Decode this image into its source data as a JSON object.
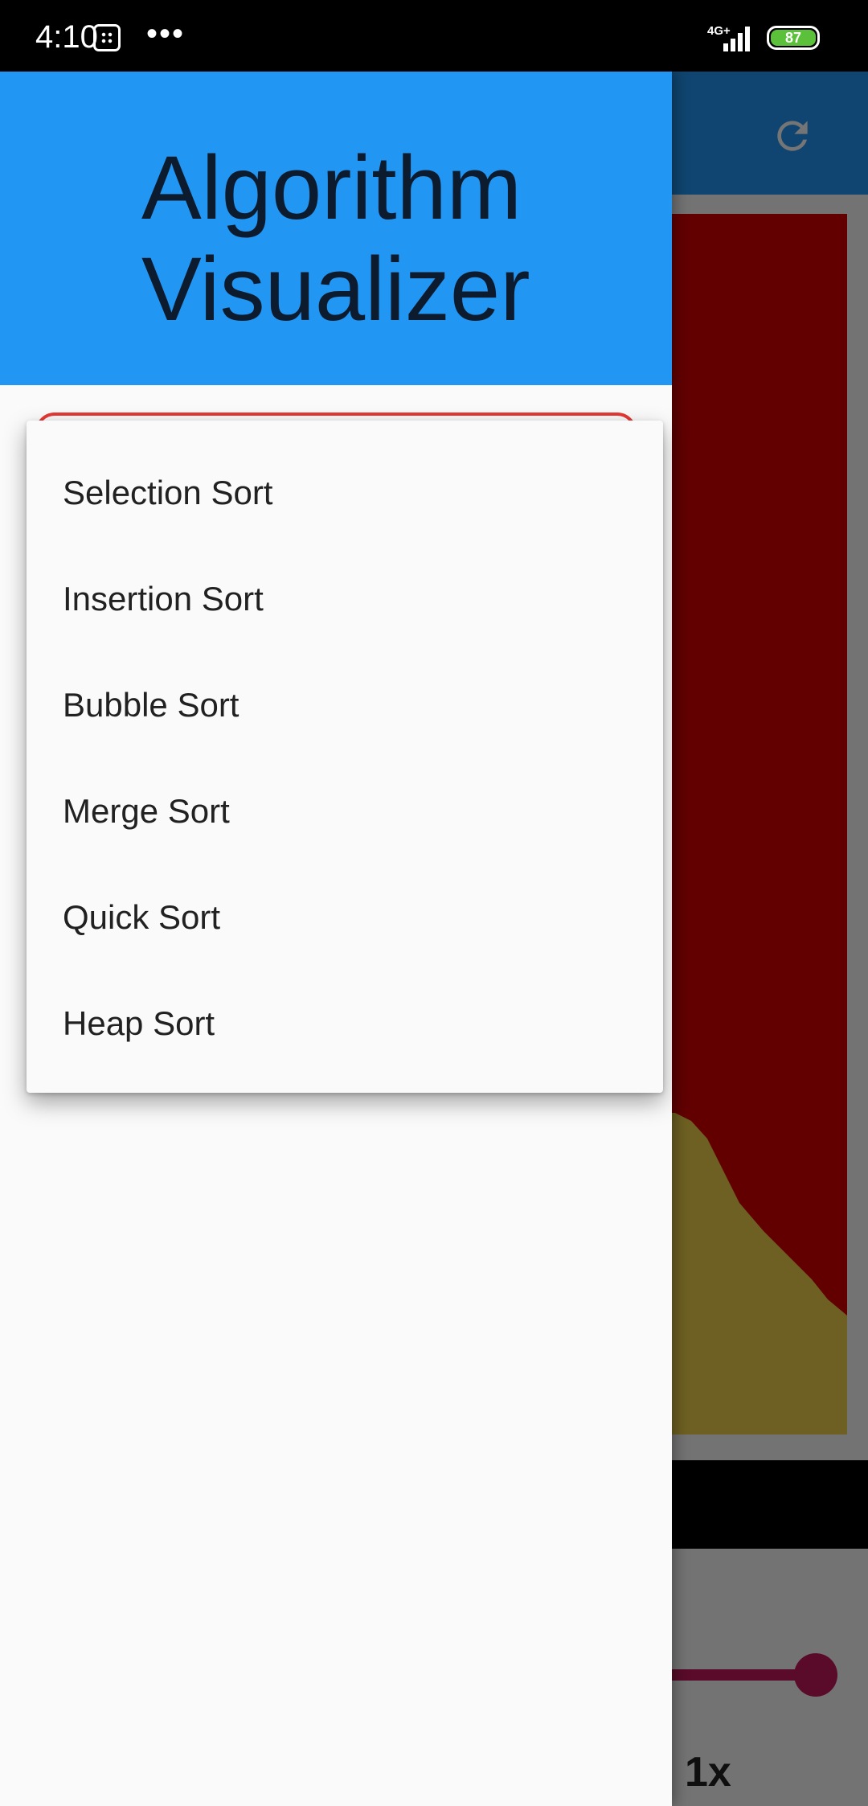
{
  "status_bar": {
    "time": "4:10",
    "more": "•••",
    "network": "4G+",
    "battery": "87",
    "battery_color": "#5cc13a"
  },
  "drawer": {
    "title_line1": "Algorithm",
    "title_line2": "Visualizer",
    "header_color": "#2196f3",
    "select_outline_color": "#e53935"
  },
  "dropdown": {
    "options": [
      "Selection Sort",
      "Insertion Sort",
      "Bubble Sort",
      "Merge Sort",
      "Quick Sort",
      "Heap Sort"
    ]
  },
  "background_app": {
    "refresh_icon": "refresh-icon",
    "speed_label": "1x",
    "slider_color": "#c2185b",
    "speed_slider_value": 1.0,
    "bar_sorted_color": "#d50000",
    "bar_unsorted_color": "#f0d14a"
  }
}
